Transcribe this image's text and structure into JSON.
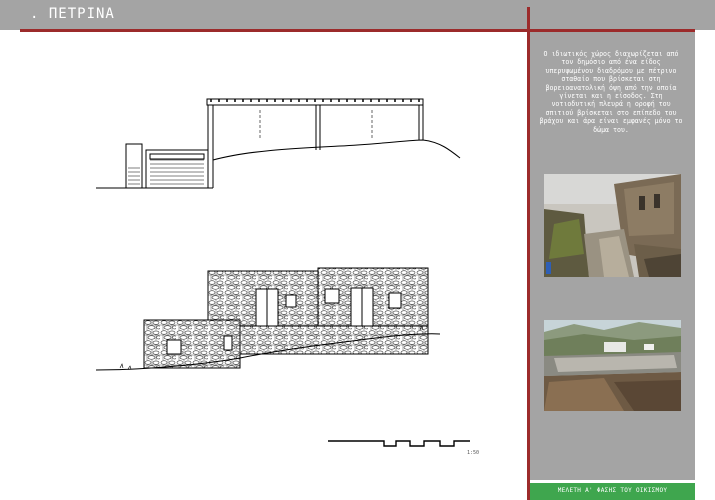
{
  "header": {
    "title": ". ΠΕΤΡΙΝΑ"
  },
  "sidebar": {
    "description": "Ο ιδιωτικός χώρος διαχωρίζεται από τον δημόσιο από ένα είδος υπερυψωμένου διαδρόμου με πέτρινο σταθαίο που βρίσκεται στη βορειοανατολική όψη από την οποία γίνεται και η είσοδος. Στη νοτιοδυτική πλευρά η οροφή του σπιτιού βρίσκεται στο επίπεδο του βράχου και άρα είναι εμφανές μόνο το δώμα του.",
    "footer": "ΜΕΛΕΤΗ Α' ΦΑΣΗΣ ΤΟΥ ΟΙΚΙΣΜΟΥ"
  },
  "scale_label": "1:50",
  "colors": {
    "header_bg": "#a4a4a4",
    "accent_red": "#9c2b2b",
    "footer_green": "#3fa64e"
  }
}
